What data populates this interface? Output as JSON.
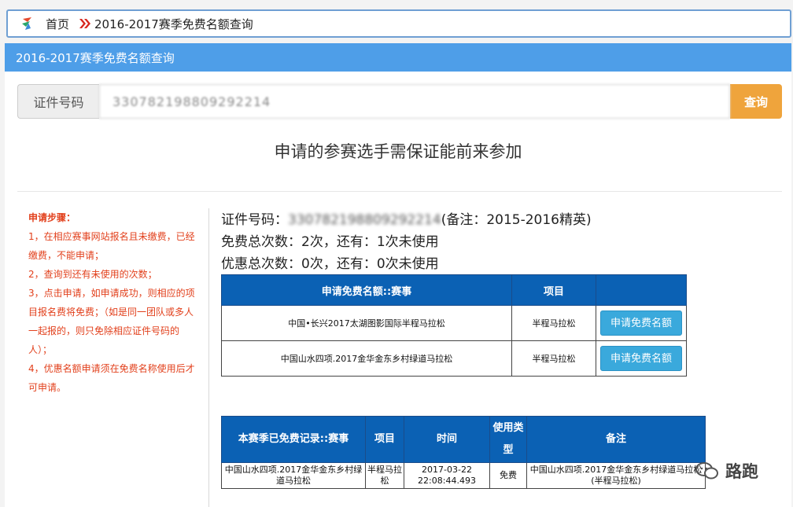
{
  "breadcrumb": {
    "home": "首页",
    "current": "2016-2017赛季免费名额查询"
  },
  "panel": {
    "title": "2016-2017赛季免费名额查询"
  },
  "search": {
    "label": "证件号码",
    "value": "330782198809292214",
    "button": "查询"
  },
  "notice": "申请的参赛选手需保证能前来参加",
  "steps": {
    "title": "申请步骤：",
    "items": [
      "1，在相应赛事网站报名且未缴费，已经缴费，不能申请；",
      "2，查询到还有未使用的次数；",
      "3，点击申请，如申请成功，则相应的项目报名费将免费；（如是同一团队或多人一起报的，则只免除相应证件号码的人）；",
      "4，优惠名额申请须在免费名称使用后才可申请。"
    ]
  },
  "info": {
    "id_prefix": "证件号码：",
    "id_value": "330782198809292214",
    "id_note": "(备注：2015-2016精英)",
    "free_line": "免费总次数：2次，还有：1次未使用",
    "discount_line": "优惠总次数：0次，还有：0次未使用"
  },
  "apply_table": {
    "headers": [
      "申请免费名额::赛事",
      "项目",
      ""
    ],
    "rows": [
      {
        "event": "中国•长兴2017太湖图影国际半程马拉松",
        "item": "半程马拉松",
        "button": "申请免费名额"
      },
      {
        "event": "中国山水四项.2017金华金东乡村绿道马拉松",
        "item": "半程马拉松",
        "button": "申请免费名额"
      }
    ]
  },
  "record_table": {
    "headers": [
      "本赛季已免费记录::赛事",
      "项目",
      "时间",
      "使用类型",
      "备注"
    ],
    "rows": [
      {
        "event": "中国山水四项.2017金华金东乡村绿道马拉松",
        "item": "半程马拉松",
        "time": "2017-03-22 22:08:44.493",
        "type": "免费",
        "note": "中国山水四项.2017金华金东乡村绿道马拉松(半程马拉松)"
      }
    ]
  },
  "watermark": "路跑"
}
